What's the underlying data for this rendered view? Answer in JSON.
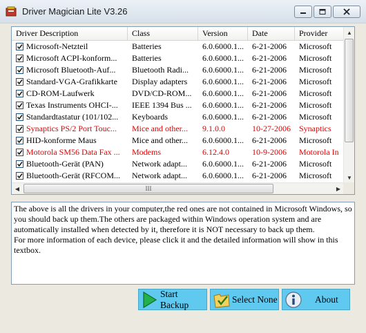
{
  "window": {
    "title": "Driver Magician Lite V3.26"
  },
  "columns": [
    "Driver Description",
    "Class",
    "Version",
    "Date",
    "Provider"
  ],
  "rows": [
    {
      "desc": "Microsoft-Netzteil",
      "class": "Batteries",
      "version": "6.0.6000.1...",
      "date": "6-21-2006",
      "provider": "Microsoft",
      "red": false
    },
    {
      "desc": "Microsoft ACPI-konform...",
      "class": "Batteries",
      "version": "6.0.6000.1...",
      "date": "6-21-2006",
      "provider": "Microsoft",
      "red": false
    },
    {
      "desc": "Microsoft Bluetooth-Auf...",
      "class": "Bluetooth Radi...",
      "version": "6.0.6000.1...",
      "date": "6-21-2006",
      "provider": "Microsoft",
      "red": false
    },
    {
      "desc": "Standard-VGA-Grafikkarte",
      "class": "Display adapters",
      "version": "6.0.6000.1...",
      "date": "6-21-2006",
      "provider": "Microsoft",
      "red": false
    },
    {
      "desc": "CD-ROM-Laufwerk",
      "class": "DVD/CD-ROM...",
      "version": "6.0.6000.1...",
      "date": "6-21-2006",
      "provider": "Microsoft",
      "red": false
    },
    {
      "desc": "Texas Instruments OHCI-...",
      "class": "IEEE 1394 Bus ...",
      "version": "6.0.6000.1...",
      "date": "6-21-2006",
      "provider": "Microsoft",
      "red": false
    },
    {
      "desc": "Standardtastatur (101/102...",
      "class": "Keyboards",
      "version": "6.0.6000.1...",
      "date": "6-21-2006",
      "provider": "Microsoft",
      "red": false
    },
    {
      "desc": "Synaptics PS/2 Port Touc...",
      "class": "Mice and other...",
      "version": "9.1.0.0",
      "date": "10-27-2006",
      "provider": "Synaptics",
      "red": true
    },
    {
      "desc": "HID-konforme Maus",
      "class": "Mice and other...",
      "version": "6.0.6000.1...",
      "date": "6-21-2006",
      "provider": "Microsoft",
      "red": false
    },
    {
      "desc": "Motorola SM56 Data Fax ...",
      "class": "Modems",
      "version": "6.12.4.0",
      "date": "10-9-2006",
      "provider": "Motorola In",
      "red": true
    },
    {
      "desc": "Bluetooth-Gerät (PAN)",
      "class": "Network adapt...",
      "version": "6.0.6000.1...",
      "date": "6-21-2006",
      "provider": "Microsoft",
      "red": false
    },
    {
      "desc": "Bluetooth-Gerät (RFCOM...",
      "class": "Network adapt...",
      "version": "6.0.6000.1...",
      "date": "6-21-2006",
      "provider": "Microsoft",
      "red": false
    }
  ],
  "hscroll_grip": "III",
  "info_text": "The above is all the drivers in your computer,the red ones are not contained in Microsoft Windows, so you should back up them.The others are packaged within Windows operation system and are automatically installed when detected by it, therefore it is NOT necessary to back up them.\nFor more information of each device, please click it and the detailed information will show in this textbox.",
  "buttons": {
    "backup": "Start Backup",
    "select_none": "Select None",
    "about": "About"
  },
  "colors": {
    "red_text": "#e00000",
    "button_bg": "#5fc9f0"
  }
}
